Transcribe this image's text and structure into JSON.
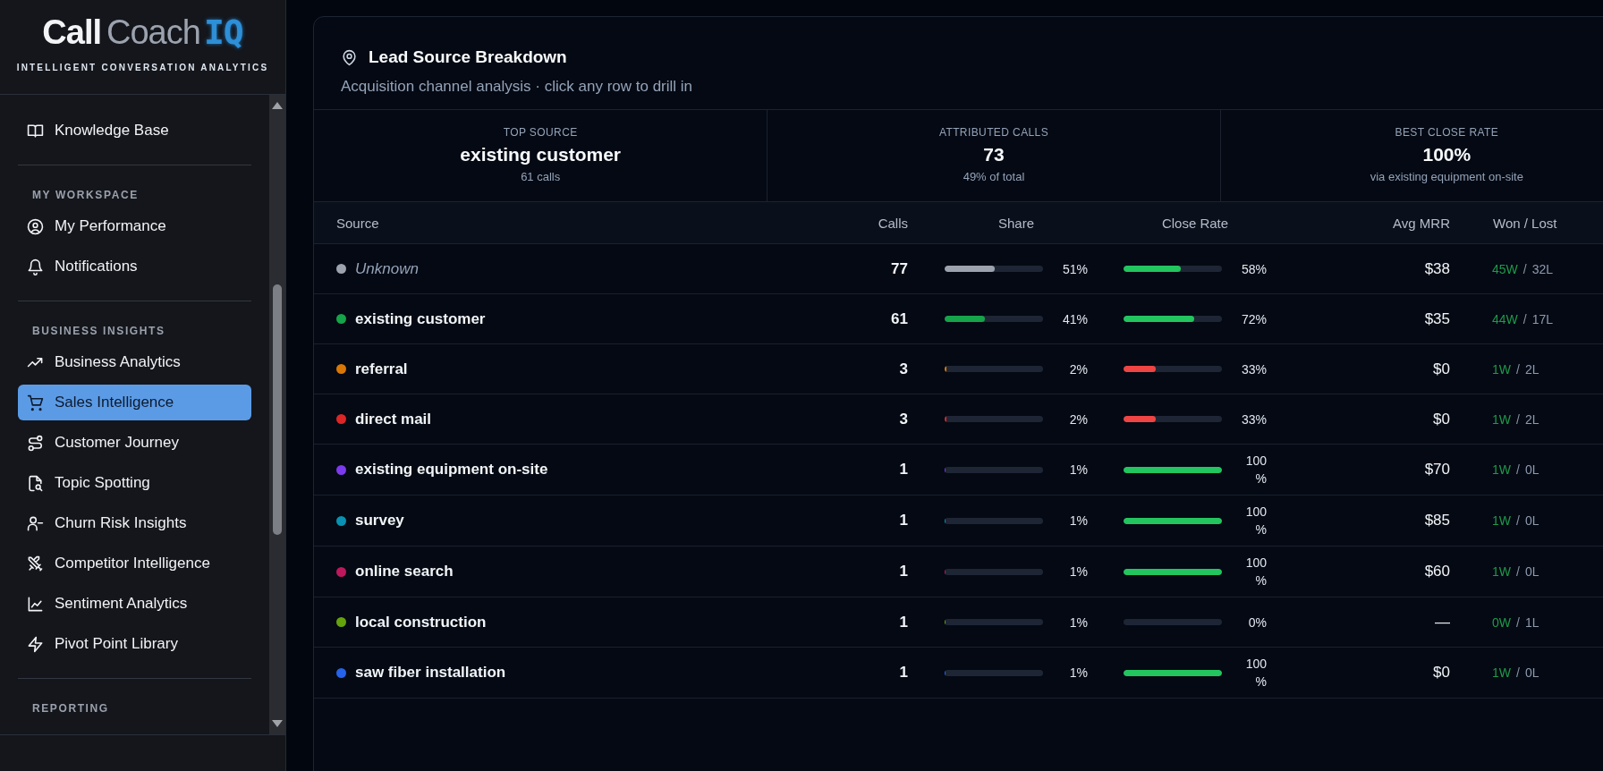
{
  "logo": {
    "word_1": "Call",
    "word_2": "Coach",
    "word_3": "IQ",
    "tagline": "INTELLIGENT CONVERSATION ANALYTICS"
  },
  "sidebar": {
    "sections": [
      {
        "items": [
          {
            "label": "Knowledge Base",
            "selected": false
          }
        ]
      },
      {
        "heading": "MY WORKSPACE",
        "items": [
          {
            "label": "My Performance",
            "selected": false
          },
          {
            "label": "Notifications",
            "selected": false
          }
        ]
      },
      {
        "heading": "BUSINESS INSIGHTS",
        "items": [
          {
            "label": "Business Analytics",
            "selected": false
          },
          {
            "label": "Sales Intelligence",
            "selected": true
          },
          {
            "label": "Customer Journey",
            "selected": false
          },
          {
            "label": "Topic Spotting",
            "selected": false
          },
          {
            "label": "Churn Risk Insights",
            "selected": false
          },
          {
            "label": "Competitor Intelligence",
            "selected": false
          },
          {
            "label": "Sentiment Analytics",
            "selected": false
          },
          {
            "label": "Pivot Point Library",
            "selected": false
          }
        ]
      },
      {
        "heading": "REPORTING"
      }
    ]
  },
  "card": {
    "title": "Lead Source Breakdown",
    "subtitle": "Acquisition channel analysis · click any row to drill in",
    "stats": [
      {
        "label": "TOP SOURCE",
        "value": "existing customer",
        "note": "61 calls"
      },
      {
        "label": "ATTRIBUTED CALLS",
        "value": "73",
        "note": "49% of total"
      },
      {
        "label": "BEST CLOSE RATE",
        "value": "100%",
        "note": "via existing equipment on-site"
      }
    ],
    "table": {
      "columns": [
        "Source",
        "Calls",
        "Share",
        "Close Rate",
        "Avg MRR",
        "Won / Lost"
      ],
      "rows": [
        {
          "kind": "unattributed",
          "source": "Unknown",
          "color": "#9ca3af",
          "calls": "77",
          "share": {
            "level": 0.51,
            "text": "51%"
          },
          "close_rate": {
            "level": 0.58,
            "text": "58%"
          },
          "avg_mrr": "$38",
          "won": "45W",
          "sep": "/",
          "lost": "32L"
        },
        {
          "kind": "source",
          "source": "existing customer",
          "color": "#16a34a",
          "calls": "61",
          "share": {
            "level": 0.41,
            "text": "41%"
          },
          "close_rate": {
            "level": 0.72,
            "text": "72%"
          },
          "avg_mrr": "$35",
          "won": "44W",
          "sep": "/",
          "lost": "17L"
        },
        {
          "kind": "source",
          "source": "referral",
          "color": "#d97706",
          "calls": "3",
          "share": {
            "level": 0.02,
            "text": "2%"
          },
          "close_rate": {
            "level": 0.33,
            "text": "33%"
          },
          "avg_mrr": "$0",
          "won": "1W",
          "sep": "/",
          "lost": "2L"
        },
        {
          "kind": "source",
          "source": "direct mail",
          "color": "#dc2626",
          "calls": "3",
          "share": {
            "level": 0.02,
            "text": "2%"
          },
          "close_rate": {
            "level": 0.33,
            "text": "33%"
          },
          "avg_mrr": "$0",
          "won": "1W",
          "sep": "/",
          "lost": "2L"
        },
        {
          "kind": "source",
          "source": "existing equipment on-site",
          "color": "#7c3aed",
          "calls": "1",
          "share": {
            "level": 0.01,
            "text": "1%"
          },
          "close_rate": {
            "level": 1,
            "text": "100%"
          },
          "avg_mrr": "$70",
          "won": "1W",
          "sep": "/",
          "lost": "0L"
        },
        {
          "kind": "source",
          "source": "survey",
          "color": "#0891b2",
          "calls": "1",
          "share": {
            "level": 0.01,
            "text": "1%"
          },
          "close_rate": {
            "level": 1,
            "text": "100%"
          },
          "avg_mrr": "$85",
          "won": "1W",
          "sep": "/",
          "lost": "0L"
        },
        {
          "kind": "source",
          "source": "online search",
          "color": "#be185d",
          "calls": "1",
          "share": {
            "level": 0.01,
            "text": "1%"
          },
          "close_rate": {
            "level": 1,
            "text": "100%"
          },
          "avg_mrr": "$60",
          "won": "1W",
          "sep": "/",
          "lost": "0L"
        },
        {
          "kind": "source",
          "source": "local construction",
          "color": "#65a30d",
          "calls": "1",
          "share": {
            "level": 0.01,
            "text": "1%"
          },
          "close_rate": {
            "level": 0,
            "text": "0%"
          },
          "avg_mrr": "—",
          "won": "0W",
          "sep": "/",
          "lost": "1L"
        },
        {
          "kind": "source",
          "source": "saw fiber installation",
          "color": "#2563eb",
          "calls": "1",
          "share": {
            "level": 0.01,
            "text": "1%"
          },
          "close_rate": {
            "level": 1,
            "text": "100%"
          },
          "avg_mrr": "$0",
          "won": "1W",
          "sep": "/",
          "lost": "0L"
        }
      ]
    }
  }
}
